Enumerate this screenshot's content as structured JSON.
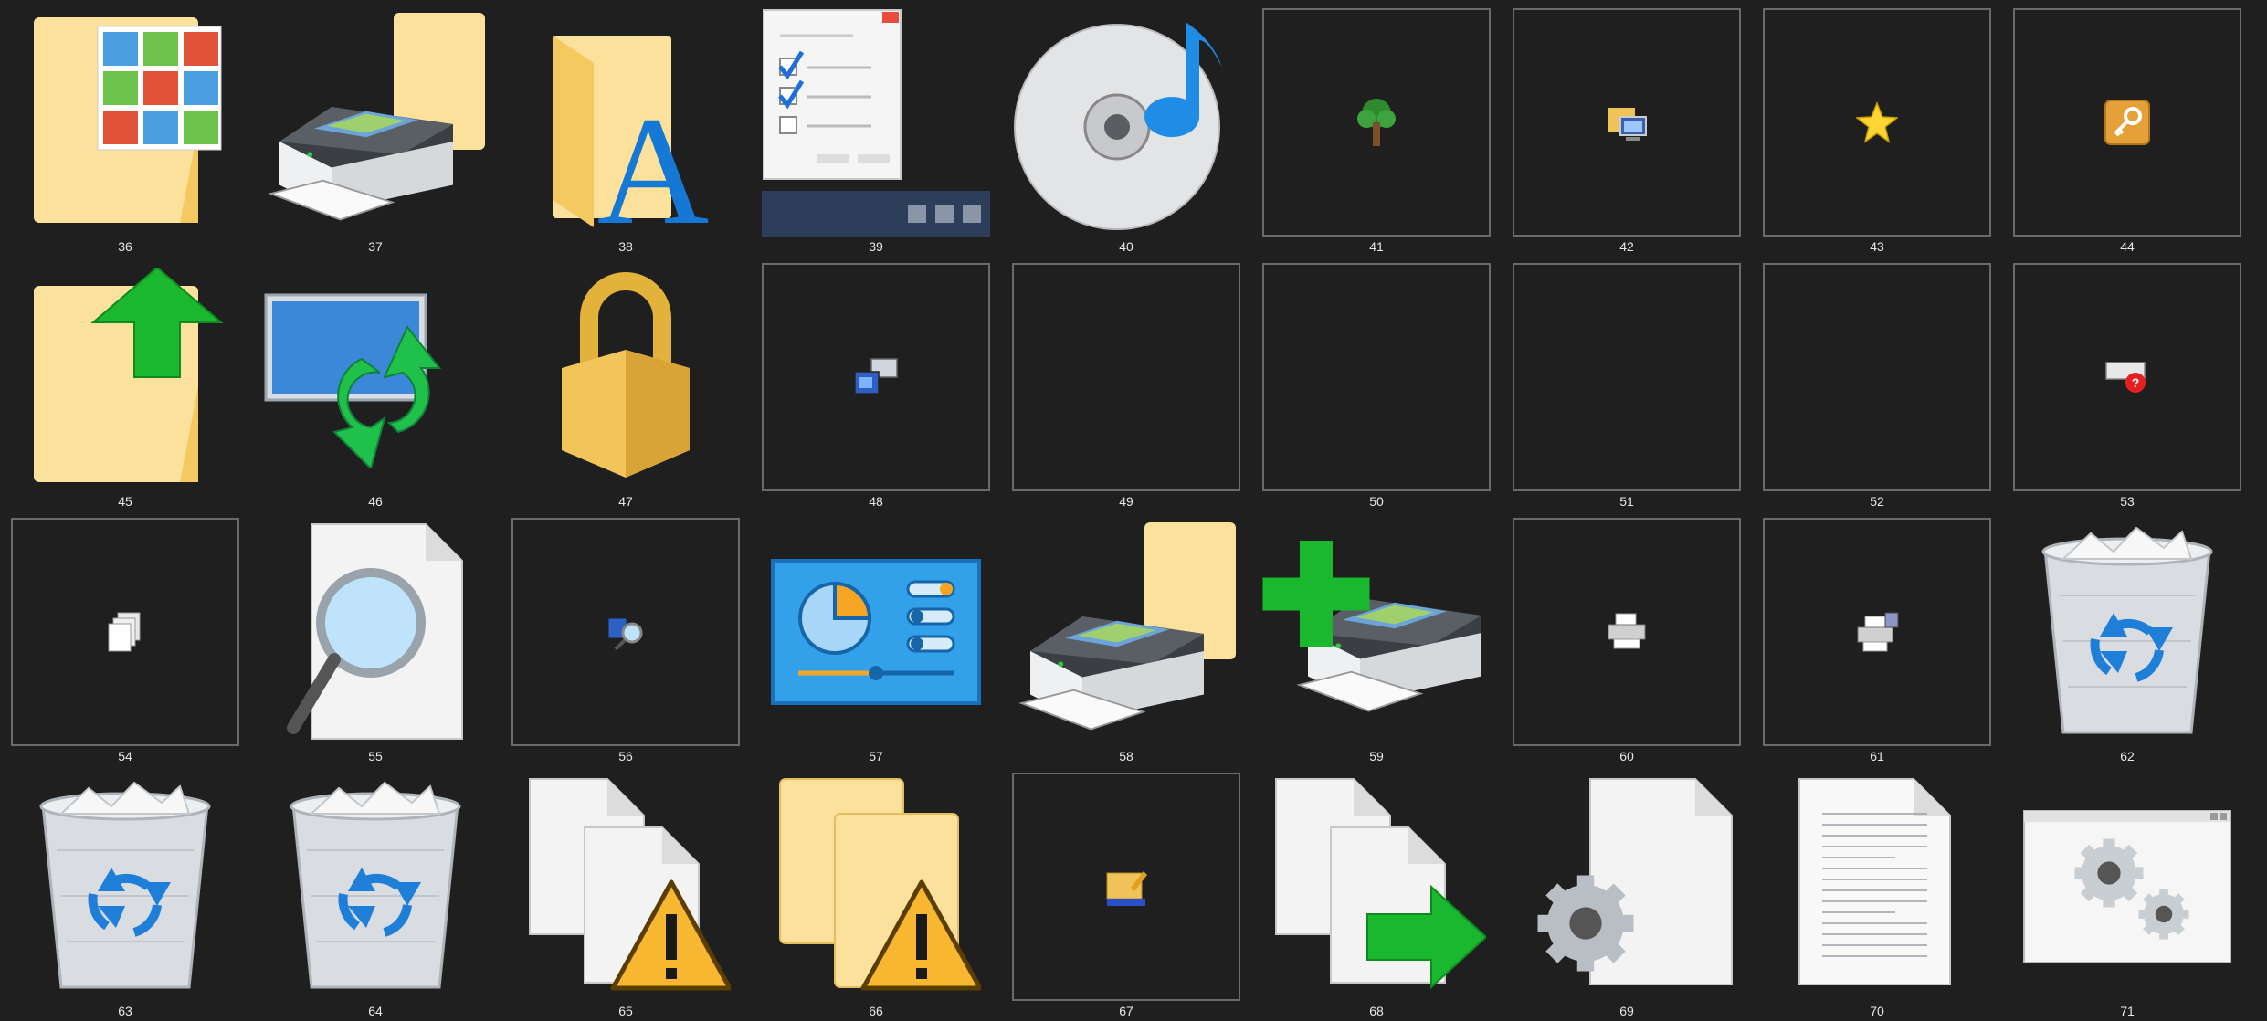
{
  "icons": [
    {
      "label": "36",
      "icon": "pictures-folder-icon"
    },
    {
      "label": "37",
      "icon": "printer-folder-icon"
    },
    {
      "label": "38",
      "icon": "fonts-folder-icon"
    },
    {
      "label": "39",
      "icon": "dialog-checkbox-icon"
    },
    {
      "label": "40",
      "icon": "music-cd-icon"
    },
    {
      "label": "41",
      "icon": "tree-icon"
    },
    {
      "label": "42",
      "icon": "network-folder-icon"
    },
    {
      "label": "43",
      "icon": "star-icon"
    },
    {
      "label": "44",
      "icon": "key-icon"
    },
    {
      "label": "45",
      "icon": "folder-upload-icon"
    },
    {
      "label": "46",
      "icon": "monitor-sync-icon"
    },
    {
      "label": "47",
      "icon": "padlock-icon"
    },
    {
      "label": "48",
      "icon": "system-settings-icon"
    },
    {
      "label": "49",
      "icon": "blank-icon"
    },
    {
      "label": "50",
      "icon": "blank-icon"
    },
    {
      "label": "51",
      "icon": "blank-icon"
    },
    {
      "label": "52",
      "icon": "blank-icon"
    },
    {
      "label": "53",
      "icon": "drive-help-icon"
    },
    {
      "label": "54",
      "icon": "documents-stack-icon"
    },
    {
      "label": "55",
      "icon": "search-document-icon"
    },
    {
      "label": "56",
      "icon": "network-search-icon"
    },
    {
      "label": "57",
      "icon": "control-panel-icon"
    },
    {
      "label": "58",
      "icon": "printer-folder-icon"
    },
    {
      "label": "59",
      "icon": "add-printer-icon"
    },
    {
      "label": "60",
      "icon": "small-printer-icon"
    },
    {
      "label": "61",
      "icon": "printer-fax-icon"
    },
    {
      "label": "62",
      "icon": "recycle-bin-full-icon"
    },
    {
      "label": "63",
      "icon": "recycle-bin-full-icon"
    },
    {
      "label": "64",
      "icon": "recycle-bin-full-icon"
    },
    {
      "label": "65",
      "icon": "documents-warning-icon"
    },
    {
      "label": "66",
      "icon": "folders-warning-icon"
    },
    {
      "label": "67",
      "icon": "folder-edit-icon"
    },
    {
      "label": "68",
      "icon": "documents-move-icon"
    },
    {
      "label": "69",
      "icon": "document-gear-icon"
    },
    {
      "label": "70",
      "icon": "text-document-icon"
    },
    {
      "label": "71",
      "icon": "window-gears-icon"
    }
  ]
}
